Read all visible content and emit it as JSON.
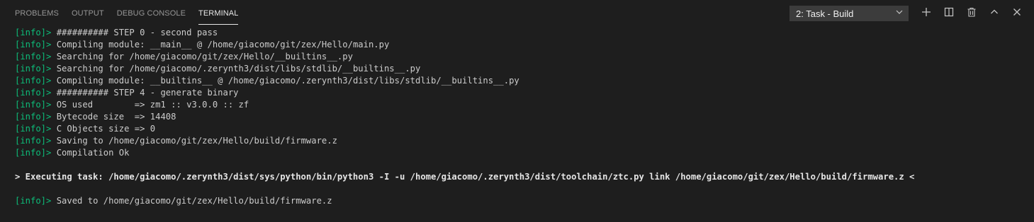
{
  "tabs": [
    {
      "label": "PROBLEMS"
    },
    {
      "label": "OUTPUT"
    },
    {
      "label": "DEBUG CONSOLE"
    },
    {
      "label": "TERMINAL"
    }
  ],
  "active_tab": "TERMINAL",
  "task_select": {
    "value": "2: Task - Build"
  },
  "actions": {
    "new_terminal": "plus-icon",
    "split_terminal": "split-icon",
    "kill_terminal": "trash-icon",
    "maximize_panel": "chevron-up-icon",
    "close_panel": "close-icon"
  },
  "colors": {
    "background": "#1e1e1e",
    "prefix": "#0dbc79",
    "text": "#cccccc"
  },
  "terminal": {
    "prefix": "[info]>",
    "log": [
      " ########## STEP 0 - second pass",
      " Compiling module: __main__ @ /home/giacomo/git/zex/Hello/main.py",
      " Searching for /home/giacomo/git/zex/Hello/__builtins__.py",
      " Searching for /home/giacomo/.zerynth3/dist/libs/stdlib/__builtins__.py",
      " Compiling module: __builtins__ @ /home/giacomo/.zerynth3/dist/libs/stdlib/__builtins__.py",
      " ########## STEP 4 - generate binary",
      " OS used        => zm1 :: v3.0.0 :: zf",
      " Bytecode size  => 14408",
      " C Objects size => 0",
      " Saving to /home/giacomo/git/zex/Hello/build/firmware.z",
      " Compilation Ok"
    ],
    "exec_line": "> Executing task: /home/giacomo/.zerynth3/dist/sys/python/bin/python3 -I -u /home/giacomo/.zerynth3/dist/toolchain/ztc.py link /home/giacomo/git/zex/Hello/build/firmware.z <",
    "final_line": " Saved to /home/giacomo/git/zex/Hello/build/firmware.z"
  }
}
